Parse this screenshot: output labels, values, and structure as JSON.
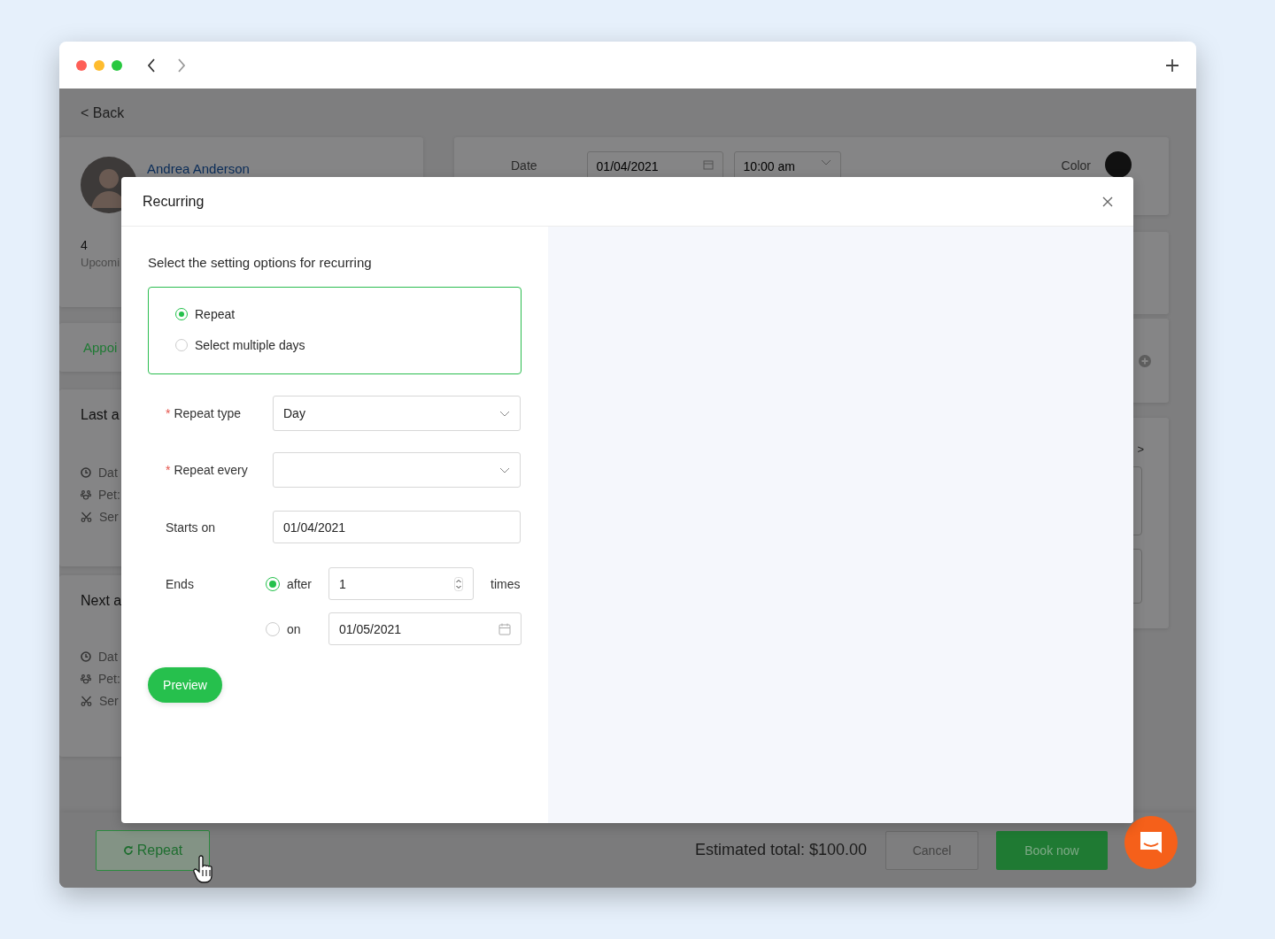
{
  "page": {
    "back_link": "< Back",
    "client": {
      "name": "Andrea Anderson",
      "count": "4",
      "count_label": "Upcomi"
    },
    "tab": "Appoi",
    "cards": [
      {
        "title": "Last a",
        "rows": [
          {
            "kind": "clock",
            "label": "Dat"
          },
          {
            "kind": "paw",
            "label": "Pet:"
          },
          {
            "kind": "scissors",
            "label": "Ser"
          }
        ]
      },
      {
        "title": "Next a",
        "rows": [
          {
            "kind": "clock",
            "label": "Dat"
          },
          {
            "kind": "paw",
            "label": "Pet:"
          },
          {
            "kind": "scissors",
            "label": "Ser"
          }
        ]
      }
    ],
    "booking": {
      "date_label": "Date",
      "date": "01/04/2021",
      "time": "10:00 am",
      "color_label": "Color",
      "side_arrow": ">"
    }
  },
  "footer": {
    "repeat_button": "Repeat",
    "total": "Estimated total: $100.00",
    "cancel": "Cancel",
    "book": "Book now"
  },
  "modal": {
    "title": "Recurring",
    "intro": "Select the setting options for recurring",
    "modes": [
      {
        "label": "Repeat",
        "selected": true
      },
      {
        "label": "Select multiple days",
        "selected": false
      }
    ],
    "fields": [
      {
        "kind": "select",
        "label": "Repeat type",
        "marker": "*",
        "value": "Day"
      },
      {
        "kind": "select",
        "label": "Repeat every",
        "marker": "*"
      },
      {
        "kind": "text",
        "label": "Starts on",
        "value": "01/04/2021"
      }
    ],
    "ends": {
      "label": "Ends",
      "options": [
        {
          "kind": "count",
          "label": "after",
          "selected": true,
          "value": "1",
          "unit": "times"
        },
        {
          "kind": "date",
          "label": "on",
          "selected": false,
          "value": "01/05/2021"
        }
      ]
    },
    "preview": "Preview"
  }
}
